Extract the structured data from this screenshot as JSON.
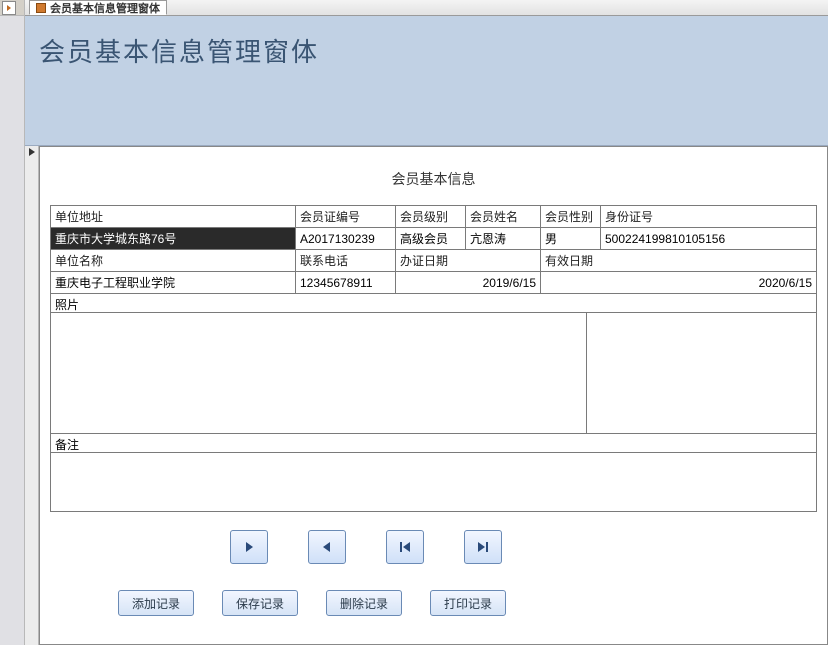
{
  "tab": {
    "title": "会员基本信息管理窗体"
  },
  "header": {
    "title": "会员基本信息管理窗体"
  },
  "section_title": "会员基本信息",
  "labels": {
    "addr": "单位地址",
    "card_no": "会员证编号",
    "level": "会员级别",
    "name": "会员姓名",
    "gender": "会员性别",
    "id_no": "身份证号",
    "org": "单位名称",
    "phone": "联系电话",
    "issue_date": "办证日期",
    "expire_date": "有效日期",
    "photo": "照片",
    "note": "备注"
  },
  "values": {
    "addr": "重庆市大学城东路76号",
    "card_no": "A2017130239",
    "level": "高级会员",
    "name": "亢恩涛",
    "gender": "男",
    "id_no": "500224199810105156",
    "org": "重庆电子工程职业学院",
    "phone": "12345678911",
    "issue_date": "2019/6/15",
    "expire_date": "2020/6/15"
  },
  "buttons": {
    "add": "添加记录",
    "save": "保存记录",
    "delete": "删除记录",
    "print": "打印记录"
  }
}
